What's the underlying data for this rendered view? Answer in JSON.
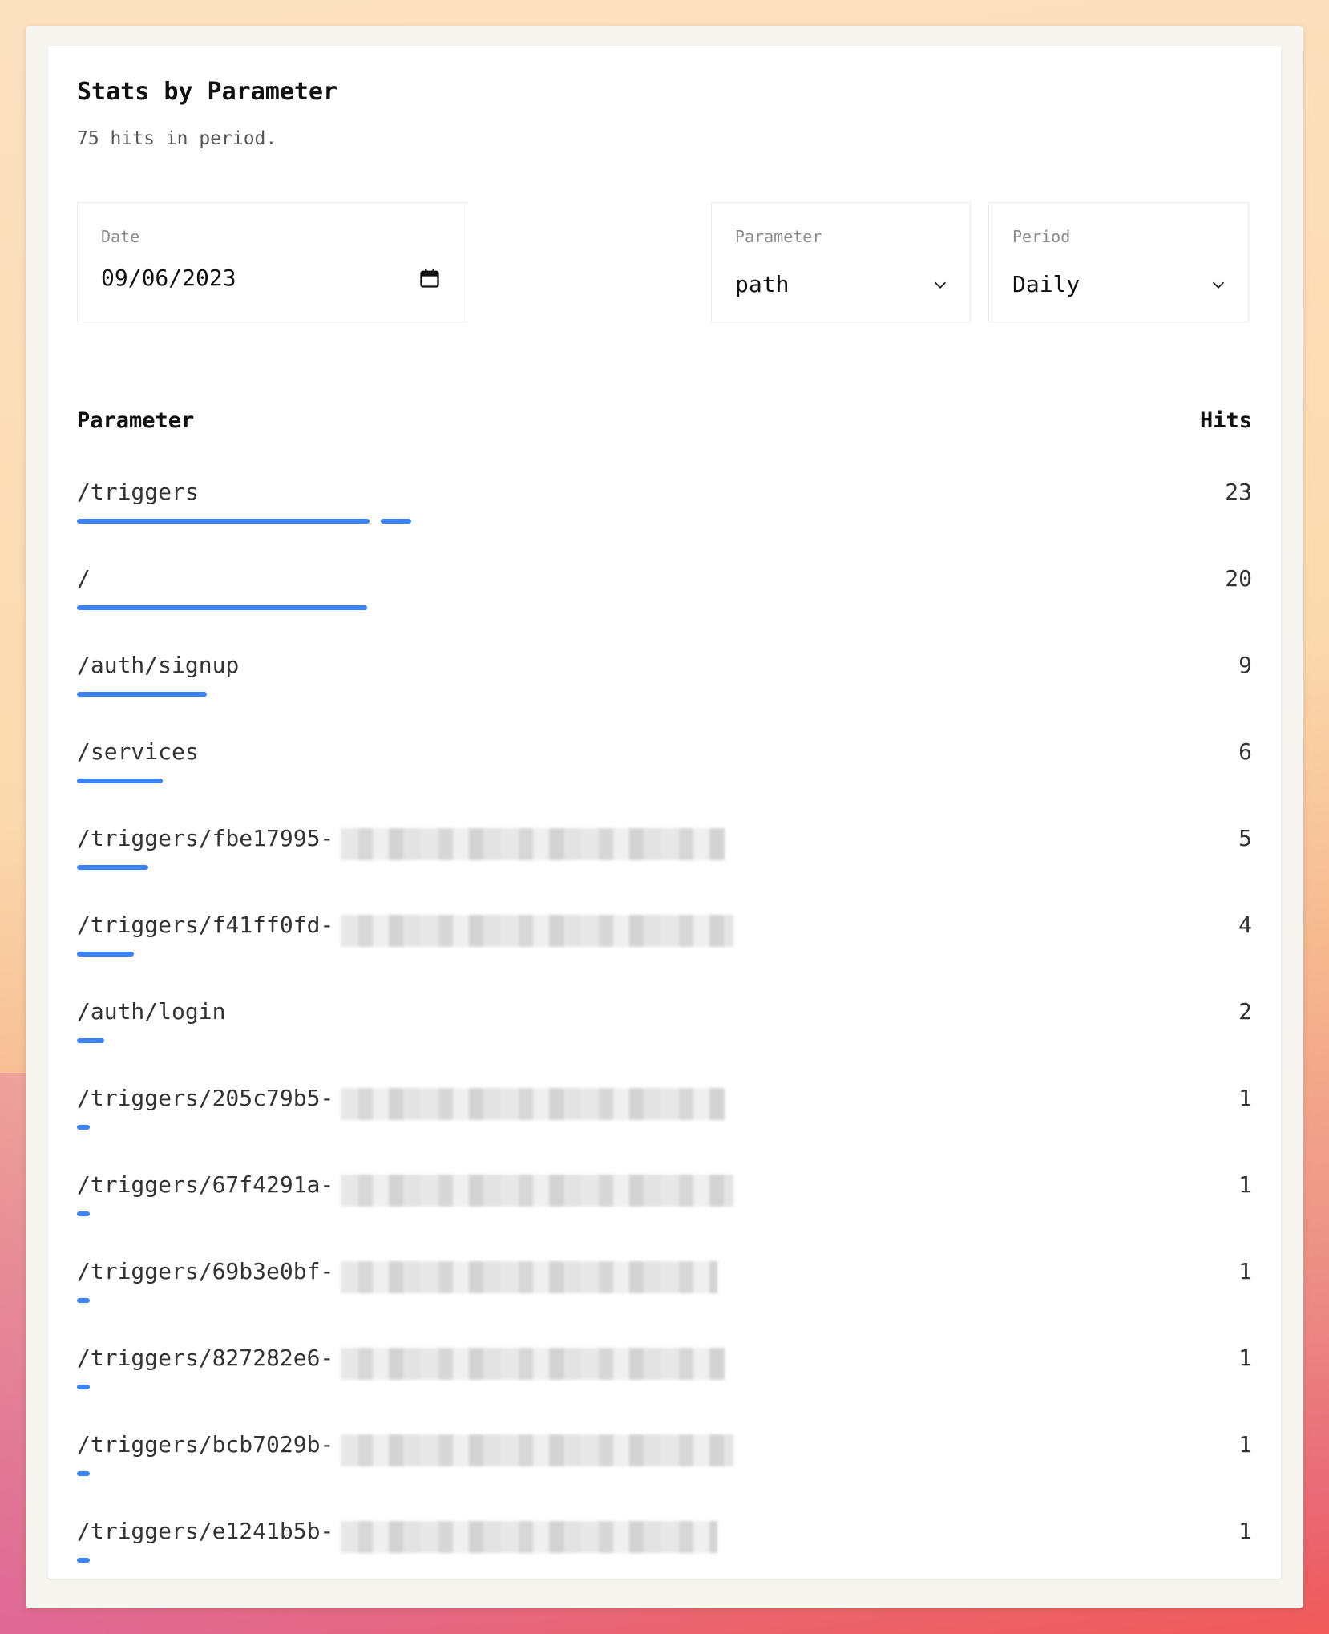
{
  "page": {
    "title": "Stats by Parameter",
    "subtitle": "75 hits in period."
  },
  "filters": {
    "date": {
      "label": "Date",
      "value": "09/06/2023"
    },
    "parameter": {
      "label": "Parameter",
      "value": "path"
    },
    "period": {
      "label": "Period",
      "value": "Daily"
    }
  },
  "table": {
    "headers": {
      "parameter": "Parameter",
      "hits": "Hits"
    },
    "accent_color": "#3b82f6",
    "rows": [
      {
        "label": "/triggers",
        "hits": "23",
        "hits_value": 23,
        "redacted": false
      },
      {
        "label": "/",
        "hits": "20",
        "hits_value": 20,
        "redacted": false
      },
      {
        "label": "/auth/signup",
        "hits": "9",
        "hits_value": 9,
        "redacted": false
      },
      {
        "label": "/services",
        "hits": "6",
        "hits_value": 6,
        "redacted": false
      },
      {
        "label": "/triggers/fbe17995-",
        "hits": "5",
        "hits_value": 5,
        "redacted": true
      },
      {
        "label": "/triggers/f41ff0fd-",
        "hits": "4",
        "hits_value": 4,
        "redacted": true
      },
      {
        "label": "/auth/login",
        "hits": "2",
        "hits_value": 2,
        "redacted": false
      },
      {
        "label": "/triggers/205c79b5-",
        "hits": "1",
        "hits_value": 1,
        "redacted": true
      },
      {
        "label": "/triggers/67f4291a-",
        "hits": "1",
        "hits_value": 1,
        "redacted": true
      },
      {
        "label": "/triggers/69b3e0bf-",
        "hits": "1",
        "hits_value": 1,
        "redacted": true
      },
      {
        "label": "/triggers/827282e6-",
        "hits": "1",
        "hits_value": 1,
        "redacted": true
      },
      {
        "label": "/triggers/bcb7029b-",
        "hits": "1",
        "hits_value": 1,
        "redacted": true
      },
      {
        "label": "/triggers/e1241b5b-",
        "hits": "1",
        "hits_value": 1,
        "redacted": true
      }
    ]
  }
}
